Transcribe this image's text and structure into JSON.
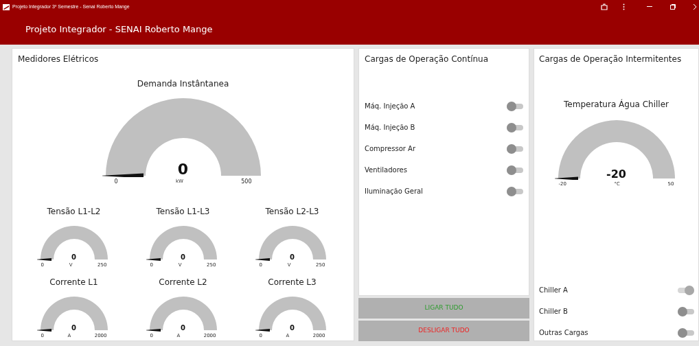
{
  "window": {
    "title": "Projeto Integrador 3º Semestre - Senai Roberto Mange"
  },
  "header": {
    "title": "Projeto Integrador - SENAI Roberto Mange"
  },
  "meters": {
    "title": "Medidores Elétricos",
    "main_gauge": {
      "title": "Demanda Instântanea",
      "value": "0",
      "unit": "kW",
      "min": "0",
      "max": "500"
    },
    "gauges": [
      {
        "title": "Tensão L1-L2",
        "value": "0",
        "unit": "V",
        "min": "0",
        "max": "250"
      },
      {
        "title": "Tensão L1-L3",
        "value": "0",
        "unit": "V",
        "min": "0",
        "max": "250"
      },
      {
        "title": "Tensão L2-L3",
        "value": "0",
        "unit": "V",
        "min": "0",
        "max": "250"
      },
      {
        "title": "Corrente L1",
        "value": "0",
        "unit": "A",
        "min": "0",
        "max": "2000"
      },
      {
        "title": "Corrente L2",
        "value": "0",
        "unit": "A",
        "min": "0",
        "max": "2000"
      },
      {
        "title": "Corrente L3",
        "value": "0",
        "unit": "A",
        "min": "0",
        "max": "2000"
      }
    ]
  },
  "continuous": {
    "title": "Cargas de Operação Contínua",
    "loads": [
      {
        "label": "Máq. Injeção A",
        "on": false
      },
      {
        "label": "Máq. Injeção B",
        "on": false
      },
      {
        "label": "Compressor Ar",
        "on": false
      },
      {
        "label": "Ventiladores",
        "on": false
      },
      {
        "label": "Iluminação Geral",
        "on": false
      }
    ],
    "buttons": [
      {
        "label": "LIGAR TUDO",
        "kind": "on"
      },
      {
        "label": "DESLIGAR TUDO",
        "kind": "off"
      }
    ]
  },
  "intermittent": {
    "title": "Cargas de Operação Intermitentes",
    "gauge": {
      "title": "Temperatura Água Chiller",
      "value": "-20",
      "unit": "°C",
      "min": "-20",
      "max": "50"
    },
    "loads": [
      {
        "label": "Chiller A",
        "on": true
      },
      {
        "label": "Chiller B",
        "on": false
      },
      {
        "label": "Outras Cargas",
        "on": false
      }
    ]
  }
}
